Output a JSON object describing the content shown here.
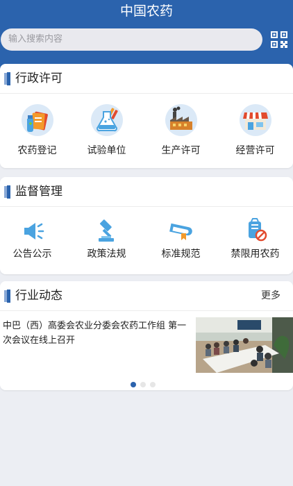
{
  "header": {
    "title": "中国农药",
    "search_placeholder": "输入搜索内容",
    "scan_icon": "qr-code-icon"
  },
  "colors": {
    "primary": "#2b63ad",
    "background": "#eceef3"
  },
  "sections": {
    "admin_permit": {
      "title": "行政许可",
      "items": [
        {
          "label": "农药登记",
          "icon": "pesticide-registration-icon"
        },
        {
          "label": "试验单位",
          "icon": "lab-flask-icon"
        },
        {
          "label": "生产许可",
          "icon": "factory-icon"
        },
        {
          "label": "经营许可",
          "icon": "store-icon"
        }
      ]
    },
    "supervision": {
      "title": "监督管理",
      "items": [
        {
          "label": "公告公示",
          "icon": "megaphone-icon"
        },
        {
          "label": "政策法规",
          "icon": "gavel-icon"
        },
        {
          "label": "标准规范",
          "icon": "book-ribbon-icon"
        },
        {
          "label": "禁限用农药",
          "icon": "prohibited-pesticide-icon"
        }
      ]
    },
    "news": {
      "title": "行业动态",
      "more_label": "更多",
      "headline": "中巴（西）高委会农业分委会农药工作组 第一次会议在线上召开",
      "carousel_pages": 3,
      "carousel_active": 1
    }
  }
}
